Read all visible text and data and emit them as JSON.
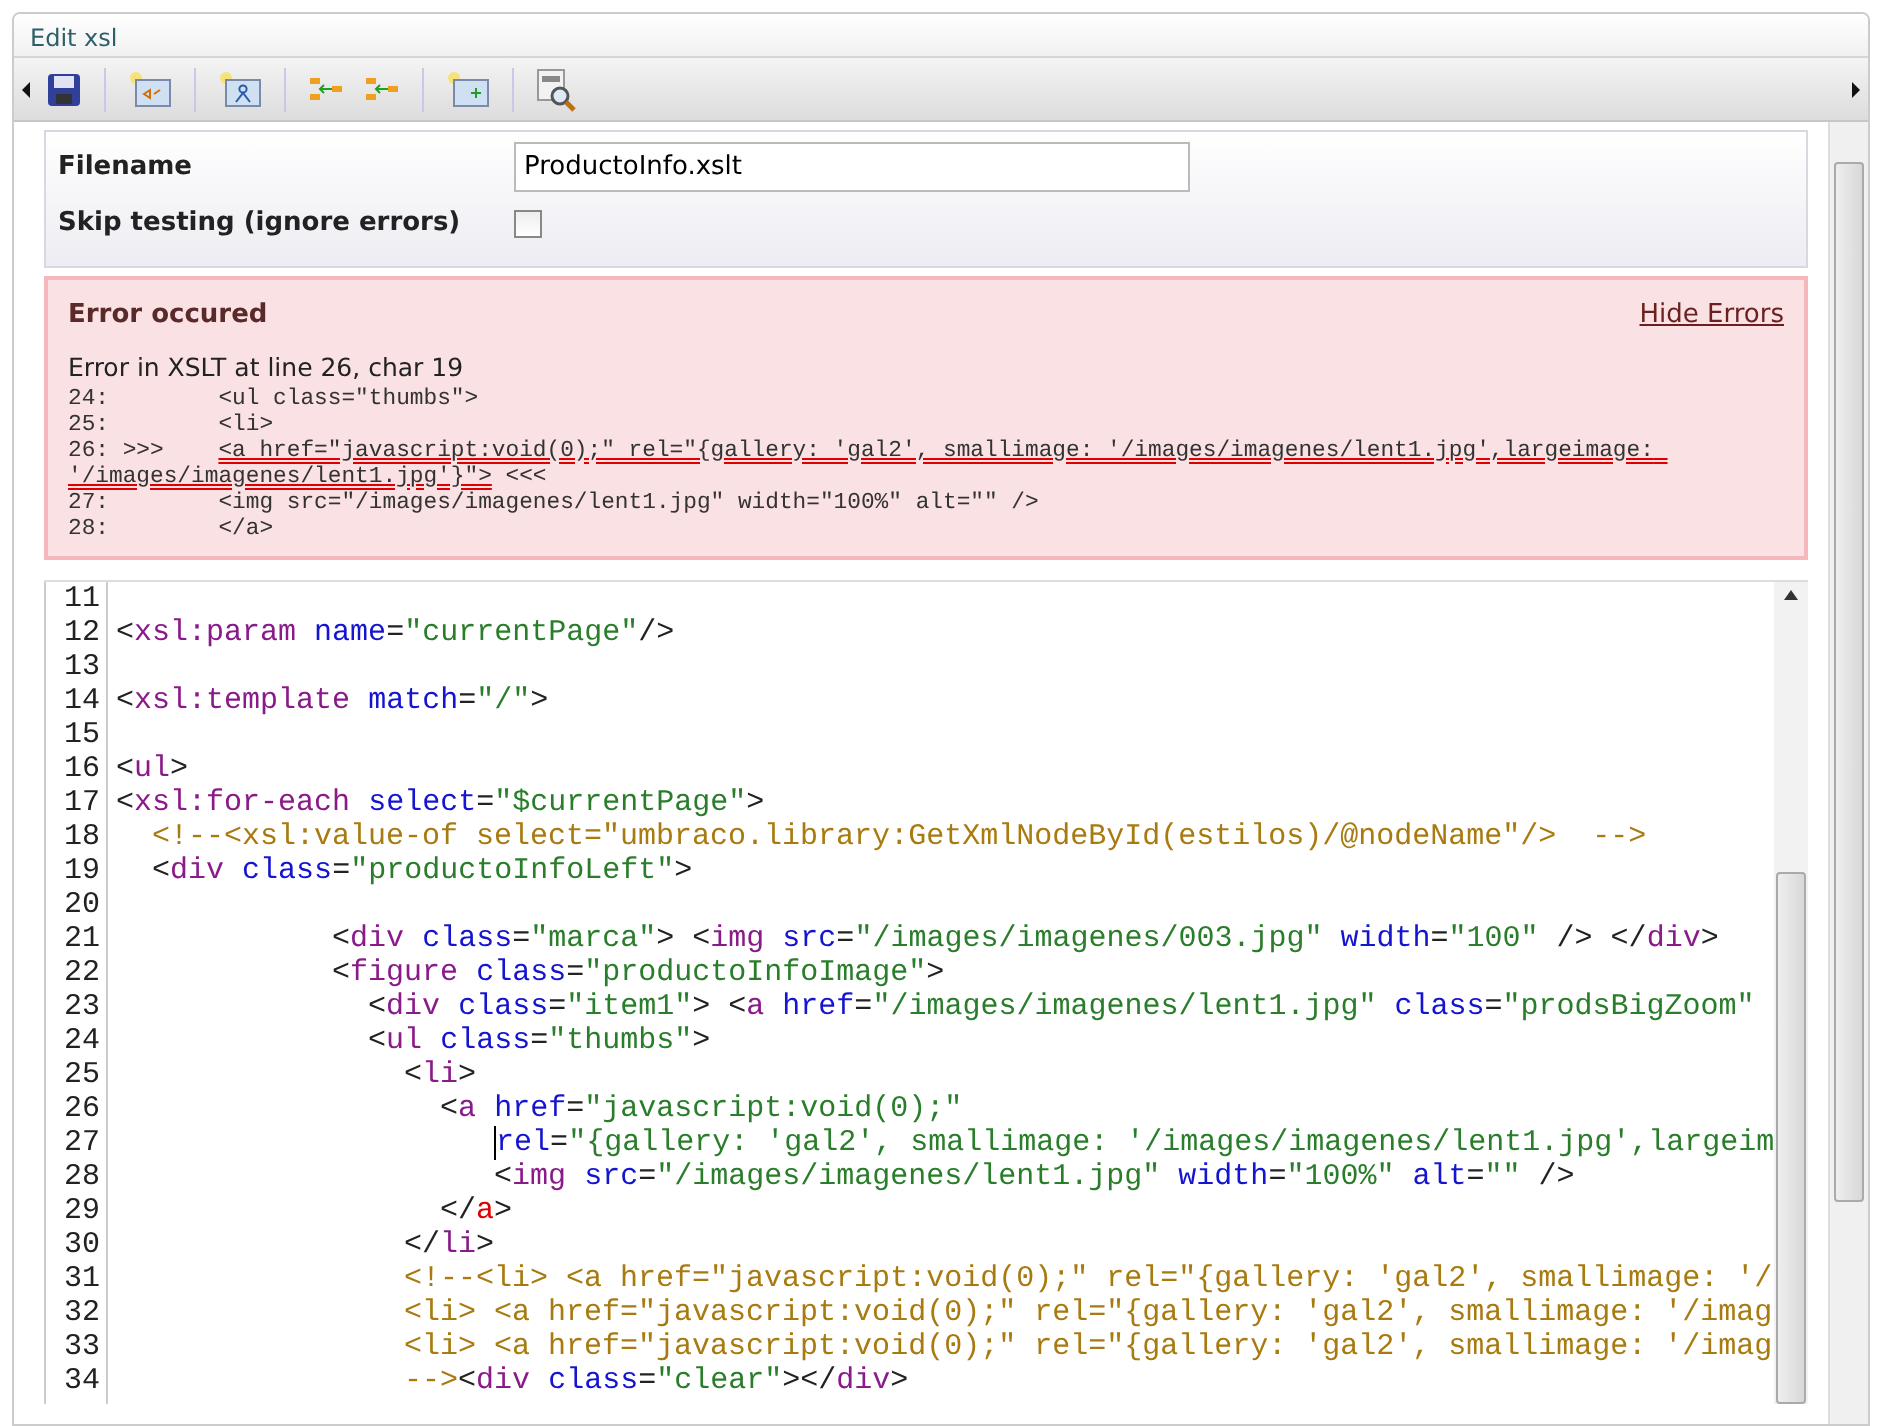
{
  "window": {
    "title": "Edit xsl"
  },
  "form": {
    "filename_label": "Filename",
    "filename_value": "ProductoInfo.xslt",
    "skip_label": "Skip testing (ignore errors)",
    "skip_checked": false
  },
  "error_panel": {
    "title": "Error occured",
    "hide_link": "Hide Errors",
    "message": "Error in XSLT at line 26, char 19",
    "lines": [
      {
        "prefix": "24:        ",
        "text": "<ul class=\"thumbs\">",
        "error": false
      },
      {
        "prefix": "25:        ",
        "text": "<li>",
        "error": false
      },
      {
        "prefix": "26: >>>    ",
        "text": "<a href=\"javascript:void(0);\" rel=\"{gallery: 'gal2', smallimage: '/images/imagenes/lent1.jpg',largeimage: '/images/imagenes/lent1.jpg'}\">",
        "suffix": " <<<",
        "error": true
      },
      {
        "prefix": "27:        ",
        "text": "<img src=\"/images/imagenes/lent1.jpg\" width=\"100%\" alt=\"\" />",
        "error": false
      },
      {
        "prefix": "28:        ",
        "text": "</a>",
        "error": false
      }
    ]
  },
  "editor": {
    "lines": [
      {
        "number": "11",
        "cursor": false
      },
      {
        "number": "12",
        "cursor": false,
        "tokens": [
          {
            "kind": "punct",
            "text": "<"
          },
          {
            "kind": "tag",
            "text": "xsl:param"
          },
          {
            "kind": "attr",
            "text": "name"
          },
          {
            "kind": "punct",
            "text": "="
          },
          {
            "kind": "value",
            "text": "\"currentPage\""
          },
          {
            "kind": "punct",
            "text": "/>"
          }
        ]
      },
      {
        "number": "13",
        "cursor": false
      },
      {
        "number": "14",
        "cursor": false,
        "tokens": [
          {
            "kind": "punct",
            "text": "<"
          },
          {
            "kind": "tag",
            "text": "xsl:template"
          },
          {
            "kind": "attr",
            "text": "match"
          },
          {
            "kind": "punct",
            "text": "="
          },
          {
            "kind": "value",
            "text": "\"/\""
          },
          {
            "kind": "punct",
            "text": ">"
          }
        ]
      },
      {
        "number": "15",
        "cursor": false
      },
      {
        "number": "16",
        "cursor": false,
        "tokens": [
          {
            "kind": "punct",
            "text": "<"
          },
          {
            "kind": "tag",
            "text": "ul"
          },
          {
            "kind": "punct",
            "text": ">"
          }
        ]
      },
      {
        "number": "17",
        "cursor": false,
        "tokens": [
          {
            "kind": "punct",
            "text": "<"
          },
          {
            "kind": "tag",
            "text": "xsl:for-each"
          },
          {
            "kind": "attr",
            "text": "select"
          },
          {
            "kind": "punct",
            "text": "="
          },
          {
            "kind": "value",
            "text": "\"$currentPage\""
          },
          {
            "kind": "punct",
            "text": ">"
          }
        ]
      },
      {
        "number": "18",
        "cursor": false,
        "tokens": [
          {
            "kind": "comment",
            "text": "  <!--<xsl:value-of select=\"umbraco.library:GetXmlNodeById(estilos)/@nodeName\"/>  -->"
          }
        ]
      },
      {
        "number": "19",
        "cursor": false,
        "tokens": [
          {
            "kind": "punct",
            "text": "  <"
          },
          {
            "kind": "tag",
            "text": "div"
          },
          {
            "kind": "attr",
            "text": "class"
          },
          {
            "kind": "punct",
            "text": "="
          },
          {
            "kind": "value",
            "text": "\"productoInfoLeft\""
          },
          {
            "kind": "punct",
            "text": ">"
          }
        ]
      },
      {
        "number": "20",
        "cursor": false
      },
      {
        "number": "21",
        "cursor": false,
        "tokens": [
          {
            "kind": "punct",
            "text": "            <"
          },
          {
            "kind": "tag",
            "text": "div"
          },
          {
            "kind": "attr",
            "text": "class"
          },
          {
            "kind": "punct",
            "text": "="
          },
          {
            "kind": "value",
            "text": "\"marca\""
          },
          {
            "kind": "punct",
            "text": "> <"
          },
          {
            "kind": "tag",
            "text": "img"
          },
          {
            "kind": "attr",
            "text": "src"
          },
          {
            "kind": "punct",
            "text": "="
          },
          {
            "kind": "value",
            "text": "\"/images/imagenes/003.jpg\""
          },
          {
            "kind": "attr",
            "text": "width"
          },
          {
            "kind": "punct",
            "text": "="
          },
          {
            "kind": "value",
            "text": "\"100\""
          },
          {
            "kind": "punct",
            "text": " /> </"
          },
          {
            "kind": "tag",
            "text": "div"
          },
          {
            "kind": "punct",
            "text": ">"
          }
        ]
      },
      {
        "number": "22",
        "cursor": false,
        "tokens": [
          {
            "kind": "punct",
            "text": "            <"
          },
          {
            "kind": "tag",
            "text": "figure"
          },
          {
            "kind": "attr",
            "text": "class"
          },
          {
            "kind": "punct",
            "text": "="
          },
          {
            "kind": "value",
            "text": "\"productoInfoImage\""
          },
          {
            "kind": "punct",
            "text": ">"
          }
        ]
      },
      {
        "number": "23",
        "cursor": false,
        "tokens": [
          {
            "kind": "punct",
            "text": "              <"
          },
          {
            "kind": "tag",
            "text": "div"
          },
          {
            "kind": "attr",
            "text": "class"
          },
          {
            "kind": "punct",
            "text": "="
          },
          {
            "kind": "value",
            "text": "\"item1\""
          },
          {
            "kind": "punct",
            "text": "> <"
          },
          {
            "kind": "tag",
            "text": "a"
          },
          {
            "kind": "attr",
            "text": "href"
          },
          {
            "kind": "punct",
            "text": "="
          },
          {
            "kind": "value",
            "text": "\"/images/imagenes/lent1.jpg\""
          },
          {
            "kind": "attr",
            "text": "class"
          },
          {
            "kind": "punct",
            "text": "="
          },
          {
            "kind": "value",
            "text": "\"prodsBigZoom\""
          }
        ]
      },
      {
        "number": "24",
        "cursor": false,
        "tokens": [
          {
            "kind": "punct",
            "text": "              <"
          },
          {
            "kind": "tag",
            "text": "ul"
          },
          {
            "kind": "attr",
            "text": "class"
          },
          {
            "kind": "punct",
            "text": "="
          },
          {
            "kind": "value",
            "text": "\"thumbs\""
          },
          {
            "kind": "punct",
            "text": ">"
          }
        ]
      },
      {
        "number": "25",
        "cursor": false,
        "tokens": [
          {
            "kind": "punct",
            "text": "                <"
          },
          {
            "kind": "tag",
            "text": "li"
          },
          {
            "kind": "punct",
            "text": ">"
          }
        ]
      },
      {
        "number": "26",
        "cursor": false,
        "tokens": [
          {
            "kind": "punct",
            "text": "                  <"
          },
          {
            "kind": "tag",
            "text": "a"
          },
          {
            "kind": "attr",
            "text": "href"
          },
          {
            "kind": "punct",
            "text": "="
          },
          {
            "kind": "value",
            "text": "\"javascript:void(0);\""
          }
        ]
      },
      {
        "number": "27",
        "cursor": true,
        "tokens": [
          {
            "kind": "attr",
            "text": "                     rel"
          },
          {
            "kind": "punct",
            "text": "="
          },
          {
            "kind": "value",
            "text": "\"{gallery: 'gal2', smallimage: '/images/imagenes/lent1.jpg',largeim"
          }
        ]
      },
      {
        "number": "28",
        "cursor": false,
        "tokens": [
          {
            "kind": "punct",
            "text": "                     <"
          },
          {
            "kind": "tag",
            "text": "img"
          },
          {
            "kind": "attr",
            "text": "src"
          },
          {
            "kind": "punct",
            "text": "="
          },
          {
            "kind": "value",
            "text": "\"/images/imagenes/lent1.jpg\""
          },
          {
            "kind": "attr",
            "text": "width"
          },
          {
            "kind": "punct",
            "text": "="
          },
          {
            "kind": "value",
            "text": "\"100%\""
          },
          {
            "kind": "attr",
            "text": "alt"
          },
          {
            "kind": "punct",
            "text": "="
          },
          {
            "kind": "value",
            "text": "\"\""
          },
          {
            "kind": "punct",
            "text": " />"
          }
        ]
      },
      {
        "number": "29",
        "cursor": false,
        "tokens": [
          {
            "kind": "punct",
            "text": "                  </"
          },
          {
            "kind": "error",
            "text": "a"
          },
          {
            "kind": "punct",
            "text": ">"
          }
        ]
      },
      {
        "number": "30",
        "cursor": false,
        "tokens": [
          {
            "kind": "punct",
            "text": "                </"
          },
          {
            "kind": "tag",
            "text": "li"
          },
          {
            "kind": "punct",
            "text": ">"
          }
        ]
      },
      {
        "number": "31",
        "cursor": false,
        "tokens": [
          {
            "kind": "comment",
            "text": "                <!--<li> <a href=\"javascript:void(0);\" rel=\"{gallery: 'gal2', smallimage: '/"
          }
        ]
      },
      {
        "number": "32",
        "cursor": false,
        "tokens": [
          {
            "kind": "comment",
            "text": "                <li> <a href=\"javascript:void(0);\" rel=\"{gallery: 'gal2', smallimage: '/imag"
          }
        ]
      },
      {
        "number": "33",
        "cursor": false,
        "tokens": [
          {
            "kind": "comment",
            "text": "                <li> <a href=\"javascript:void(0);\" rel=\"{gallery: 'gal2', smallimage: '/imag"
          }
        ]
      },
      {
        "number": "34",
        "cursor": false,
        "tokens": [
          {
            "kind": "comment",
            "text": "                -->"
          },
          {
            "kind": "punct",
            "text": "<"
          },
          {
            "kind": "tag",
            "text": "div"
          },
          {
            "kind": "attr",
            "text": "class"
          },
          {
            "kind": "punct",
            "text": "="
          },
          {
            "kind": "value",
            "text": "\"clear\""
          },
          {
            "kind": "punct",
            "text": "></"
          },
          {
            "kind": "tag",
            "text": "div"
          },
          {
            "kind": "punct",
            "text": ">"
          }
        ]
      }
    ]
  }
}
